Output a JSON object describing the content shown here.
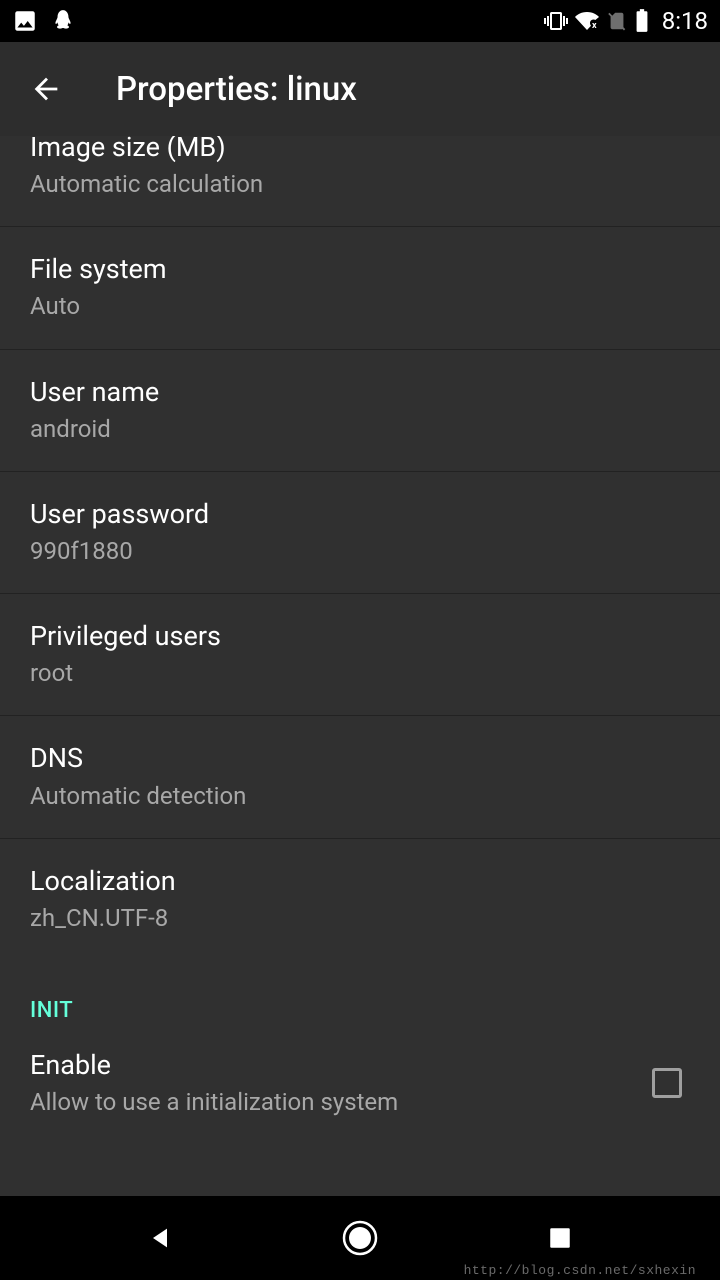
{
  "statusbar": {
    "time": "8:18"
  },
  "appbar": {
    "title": "Properties: linux"
  },
  "items": {
    "imagesize": {
      "title": "Image size (MB)",
      "sub": "Automatic calculation"
    },
    "filesystem": {
      "title": "File system",
      "sub": "Auto"
    },
    "username": {
      "title": "User name",
      "sub": "android"
    },
    "userpassword": {
      "title": "User password",
      "sub": "990f1880"
    },
    "privilegedusers": {
      "title": "Privileged users",
      "sub": "root"
    },
    "dns": {
      "title": "DNS",
      "sub": "Automatic detection"
    },
    "localization": {
      "title": "Localization",
      "sub": "zh_CN.UTF-8"
    }
  },
  "sections": {
    "init": "INIT"
  },
  "init": {
    "enable": {
      "title": "Enable",
      "sub": "Allow to use a initialization system"
    }
  },
  "watermark": "http://blog.csdn.net/sxhexin"
}
